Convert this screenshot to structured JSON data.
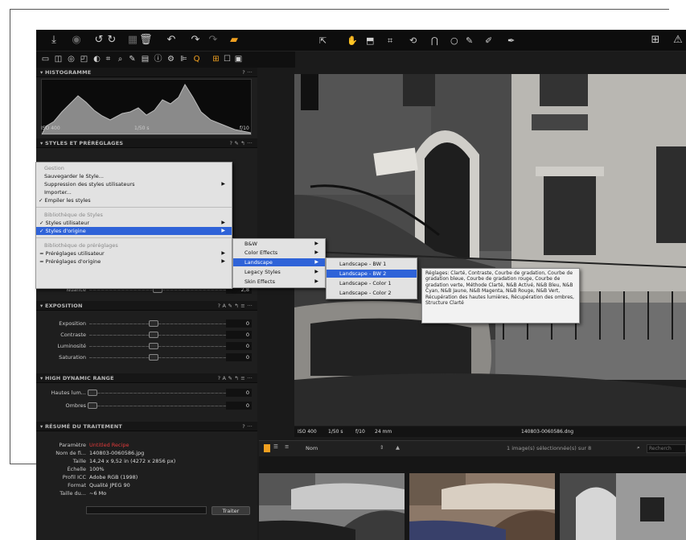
{
  "toolbar": {
    "main_icons": [
      "import-icon",
      "camera-icon",
      "rotate-left-icon",
      "rotate-right-icon",
      "grid-icon",
      "trash-icon",
      "undo-icon",
      "redo-icon",
      "redo-disabled-icon",
      "export-icon"
    ],
    "cursor_tools": [
      "select-tool",
      "pan-tool",
      "crop-mask-tool",
      "crop-tool",
      "rotate-tool",
      "keystone-tool",
      "spot-tool",
      "brush-tool",
      "eraser-tool",
      "picker-tool"
    ],
    "right_icons": [
      "compare-icon",
      "warning-icon"
    ]
  },
  "tool_tabs": [
    "library",
    "capture",
    "lens",
    "color",
    "exposure",
    "details",
    "local-adjustments",
    "output",
    "metadata",
    "settings",
    "batch",
    "search"
  ],
  "histogram": {
    "title": "HISTOGRAMME",
    "iso": "ISO 400",
    "shutter": "1/50 s",
    "aperture": "f/10"
  },
  "styles_panel": {
    "title": "STYLES ET PRÉRÉGLAGES",
    "nuance_label": "Nuance",
    "nuance_value": "2,8",
    "nuance_level": 0.45
  },
  "menu": {
    "section1_header": "Gestion",
    "save_style": "Sauvegarder le Style...",
    "remove_user_styles": "Suppression des styles utilisateurs",
    "import": "Importer...",
    "stack_styles": "Empiler les styles",
    "section2_header": "Bibliothèque de Styles",
    "user_styles": "Styles utilisateur",
    "builtin_styles": "Styles d'origine",
    "section3_header": "Bibliothèque de préréglages",
    "user_presets": "Préréglages utilisateur",
    "builtin_presets": "Préréglages d'origine"
  },
  "submenu": [
    "B&W",
    "Color Effects",
    "Landscape",
    "Legacy Styles",
    "Skin Effects"
  ],
  "landscape_menu": [
    "Landscape - BW 1",
    "Landscape - BW 2",
    "Landscape - Color 1",
    "Landscape - Color 2"
  ],
  "tooltip": "Réglages: Clarté, Contraste, Courbe de gradation, Courbe de gradation bleue, Courbe de gradation rouge, Courbe de gradation verte, Méthode Clarté, N&B Activé, N&B Bleu, N&B Cyan, N&B Jaune, N&B Magenta, N&B Rouge, N&B Vert, Récupération des hautes lumières, Récupération des ombres, Structure Clarté",
  "exposure": {
    "title": "EXPOSITION",
    "rows": [
      {
        "label": "Exposition",
        "value": "0",
        "level": 0.5
      },
      {
        "label": "Contraste",
        "value": "0",
        "level": 0.5
      },
      {
        "label": "Luminosité",
        "value": "0",
        "level": 0.5
      },
      {
        "label": "Saturation",
        "value": "0",
        "level": 0.5
      }
    ]
  },
  "hdr": {
    "title": "HIGH DYNAMIC RANGE",
    "rows": [
      {
        "label": "Hautes lum...",
        "value": "0",
        "level": 0
      },
      {
        "label": "Ombres",
        "value": "0",
        "level": 0
      }
    ]
  },
  "summary": {
    "title": "RÉSUMÉ DU TRAITEMENT",
    "rows": [
      {
        "label": "Paramètre",
        "value": "Untitled Recipe"
      },
      {
        "label": "Nom de fi...",
        "value": "140803-0060586.jpg"
      },
      {
        "label": "Taille",
        "value": "14,24 x 9,52 in (4272 x 2856 px)"
      },
      {
        "label": "Échelle",
        "value": "100%"
      },
      {
        "label": "Profil ICC",
        "value": "Adobe RGB (1998)"
      },
      {
        "label": "Format",
        "value": "Qualité JPEG 90"
      },
      {
        "label": "Taille du...",
        "value": "~6 Mo"
      }
    ],
    "process_button": "Traiter"
  },
  "viewer_info": {
    "iso": "ISO 400",
    "shutter": "1/50 s",
    "aperture": "f/10",
    "focal": "24 mm",
    "filename": "140803-0060586.dng"
  },
  "browser": {
    "sort_label": "Nom",
    "count_text": "1 image(s) sélectionnée(s) sur 8",
    "search_placeholder": "Recherch"
  },
  "colors": {
    "accent_orange": "#f0a020",
    "menu_highlight": "#2f63d8",
    "warning_red": "#e03a3a"
  }
}
